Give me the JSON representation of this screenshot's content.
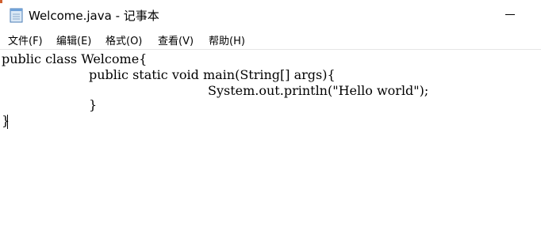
{
  "window": {
    "title": "Welcome.java - 记事本"
  },
  "menu": {
    "items": [
      {
        "label": "文件(F)"
      },
      {
        "label": "编辑(E)"
      },
      {
        "label": "格式(O)"
      },
      {
        "label": "查看(V)"
      },
      {
        "label": "帮助(H)"
      }
    ]
  },
  "editor": {
    "lines": [
      "public class Welcome{",
      "public static void main(String[] args){",
      "System.out.println(\"Hello world\");",
      "}",
      "}"
    ]
  },
  "icons": {
    "app": "notepad-icon",
    "minimize": "minimize-icon"
  },
  "colors": {
    "background": "#ffffff",
    "text": "#000000",
    "divider": "#e6e6e6"
  }
}
